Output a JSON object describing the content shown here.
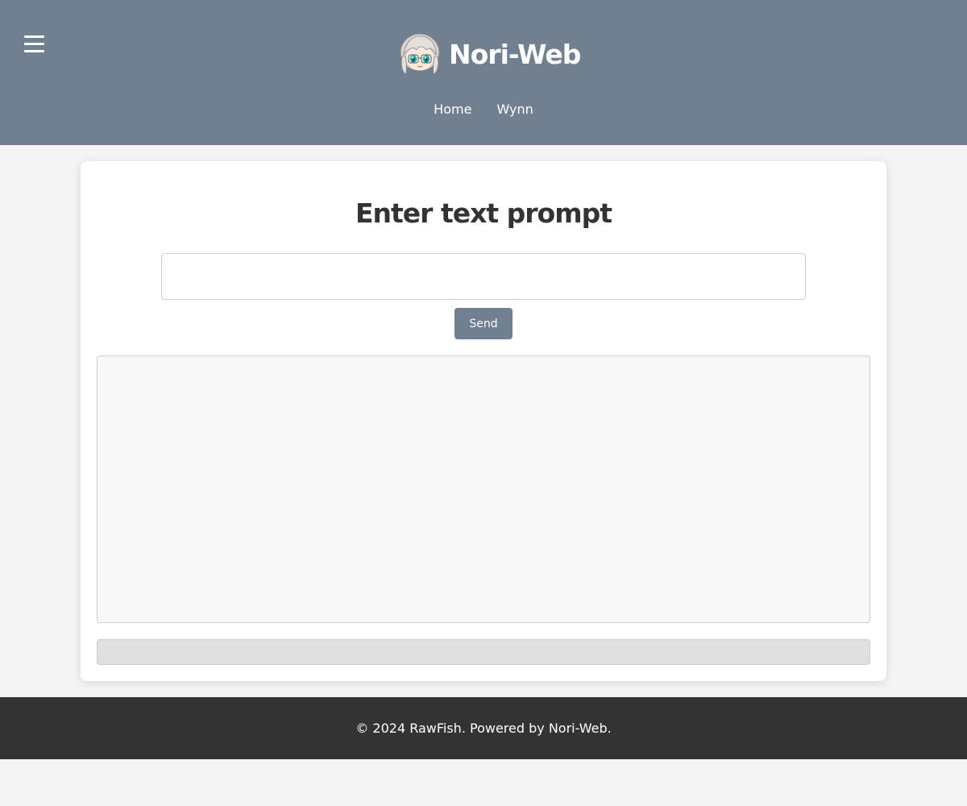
{
  "header": {
    "menu_icon": "hamburger-menu-icon",
    "brand": {
      "title": "Nori-Web",
      "avatar_icon": "anime-avatar-icon"
    },
    "nav": [
      {
        "label": "Home"
      },
      {
        "label": "Wynn"
      }
    ],
    "background": "#708090"
  },
  "main": {
    "heading": "Enter text prompt",
    "prompt_input": {
      "value": "",
      "placeholder": ""
    },
    "send_label": "Send",
    "output_text": "",
    "status_text": ""
  },
  "footer": {
    "text": "© 2024 RawFish. Powered by Nori-Web."
  },
  "colors": {
    "accent": "#708090",
    "page_background": "#f4f4f4",
    "card_background": "#ffffff",
    "footer_background": "#333333",
    "heading_text": "#333333"
  }
}
